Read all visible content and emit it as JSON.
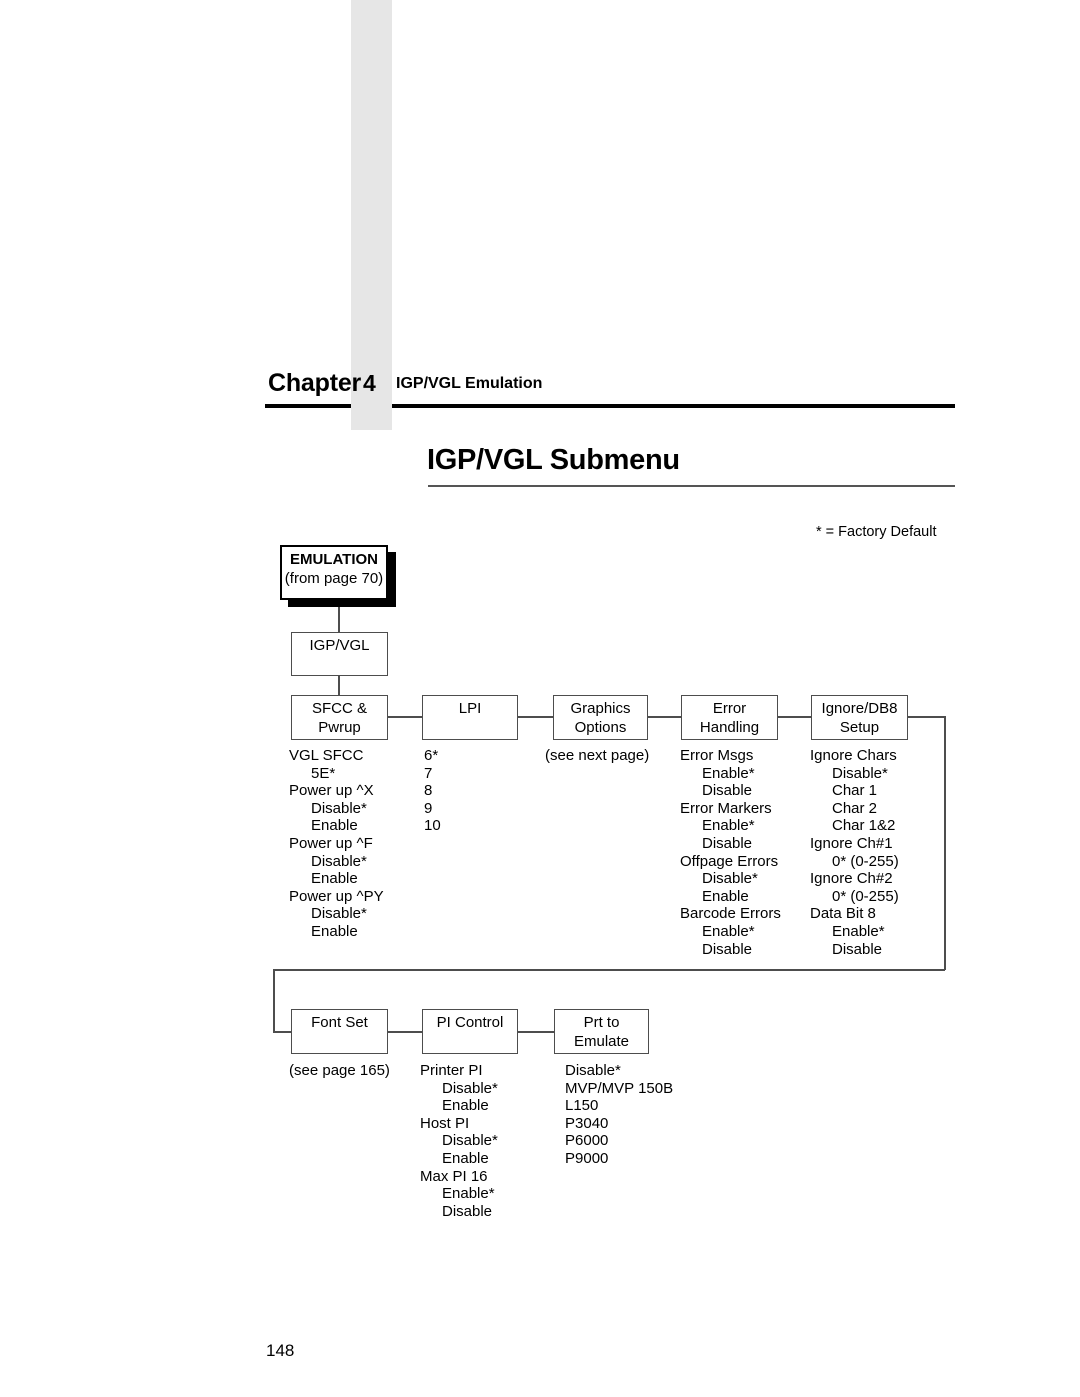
{
  "header": {
    "chapter_label": "Chapter",
    "chapter_number": "4",
    "chapter_subject": "IGP/VGL Emulation"
  },
  "page_title": "IGP/VGL Submenu",
  "legend": {
    "factory_default_note": "* = Factory Default"
  },
  "footer": {
    "page_number": "148"
  },
  "diagram": {
    "nodes": {
      "emulation": {
        "title": "EMULATION",
        "subtitle": "(from page 70)"
      },
      "igpvgl": {
        "title": "IGP/VGL",
        "subtitle": ""
      },
      "sfcc_pwrup": {
        "title": "SFCC &",
        "subtitle": "Pwrup"
      },
      "lpi": {
        "title": "LPI",
        "subtitle": ""
      },
      "graphics_options": {
        "title": "Graphics",
        "subtitle": "Options"
      },
      "error_handling": {
        "title": "Error",
        "subtitle": "Handling"
      },
      "ignore_db8_setup": {
        "title": "Ignore/DB8",
        "subtitle": "Setup"
      },
      "font_set": {
        "title": "Font Set",
        "subtitle": ""
      },
      "pi_control": {
        "title": "PI Control",
        "subtitle": ""
      },
      "prt_to_emulate": {
        "title": "Prt to",
        "subtitle": "Emulate"
      }
    },
    "option_lists": {
      "sfcc_pwrup": [
        {
          "text": "VGL SFCC",
          "level": 0
        },
        {
          "text": "5E*",
          "level": 1
        },
        {
          "text": "Power up ^X",
          "level": 0
        },
        {
          "text": "Disable*",
          "level": 1
        },
        {
          "text": "Enable",
          "level": 1
        },
        {
          "text": "Power up ^F",
          "level": 0
        },
        {
          "text": "Disable*",
          "level": 1
        },
        {
          "text": "Enable",
          "level": 1
        },
        {
          "text": "Power up ^PY",
          "level": 0
        },
        {
          "text": "Disable*",
          "level": 1
        },
        {
          "text": "Enable",
          "level": 1
        }
      ],
      "lpi": [
        {
          "text": "6*",
          "level": 0
        },
        {
          "text": "7",
          "level": 0
        },
        {
          "text": "8",
          "level": 0
        },
        {
          "text": "9",
          "level": 0
        },
        {
          "text": "10",
          "level": 0
        }
      ],
      "graphics_options": [
        {
          "text": "(see next page)",
          "level": 0
        }
      ],
      "error_handling": [
        {
          "text": "Error Msgs",
          "level": 0
        },
        {
          "text": "Enable*",
          "level": 1
        },
        {
          "text": "Disable",
          "level": 1
        },
        {
          "text": "Error Markers",
          "level": 0
        },
        {
          "text": "Enable*",
          "level": 1
        },
        {
          "text": "Disable",
          "level": 1
        },
        {
          "text": "Offpage Errors",
          "level": 0
        },
        {
          "text": "Disable*",
          "level": 1
        },
        {
          "text": "Enable",
          "level": 1
        },
        {
          "text": "Barcode Errors",
          "level": 0
        },
        {
          "text": "Enable*",
          "level": 1
        },
        {
          "text": "Disable",
          "level": 1
        }
      ],
      "ignore_db8_setup": [
        {
          "text": "Ignore Chars",
          "level": 0
        },
        {
          "text": "Disable*",
          "level": 1
        },
        {
          "text": "Char 1",
          "level": 1
        },
        {
          "text": "Char 2",
          "level": 1
        },
        {
          "text": "Char 1&2",
          "level": 1
        },
        {
          "text": "Ignore Ch#1",
          "level": 0
        },
        {
          "text": "0* (0-255)",
          "level": 1
        },
        {
          "text": "Ignore Ch#2",
          "level": 0
        },
        {
          "text": "0* (0-255)",
          "level": 1
        },
        {
          "text": "Data Bit 8",
          "level": 0
        },
        {
          "text": "Enable*",
          "level": 1
        },
        {
          "text": "Disable",
          "level": 1
        }
      ],
      "font_set": [
        {
          "text": "(see page 165)",
          "level": 0
        }
      ],
      "pi_control": [
        {
          "text": "Printer PI",
          "level": 0
        },
        {
          "text": "Disable*",
          "level": 1
        },
        {
          "text": "Enable",
          "level": 1
        },
        {
          "text": "Host PI",
          "level": 0
        },
        {
          "text": "Disable*",
          "level": 1
        },
        {
          "text": "Enable",
          "level": 1
        },
        {
          "text": "Max PI 16",
          "level": 0
        },
        {
          "text": "Enable*",
          "level": 1
        },
        {
          "text": "Disable",
          "level": 1
        }
      ],
      "prt_to_emulate": [
        {
          "text": "Disable*",
          "level": 0
        },
        {
          "text": "MVP/MVP 150B",
          "level": 0
        },
        {
          "text": "L150",
          "level": 0
        },
        {
          "text": "P3040",
          "level": 0
        },
        {
          "text": "P6000",
          "level": 0
        },
        {
          "text": "P9000",
          "level": 0
        }
      ]
    }
  }
}
